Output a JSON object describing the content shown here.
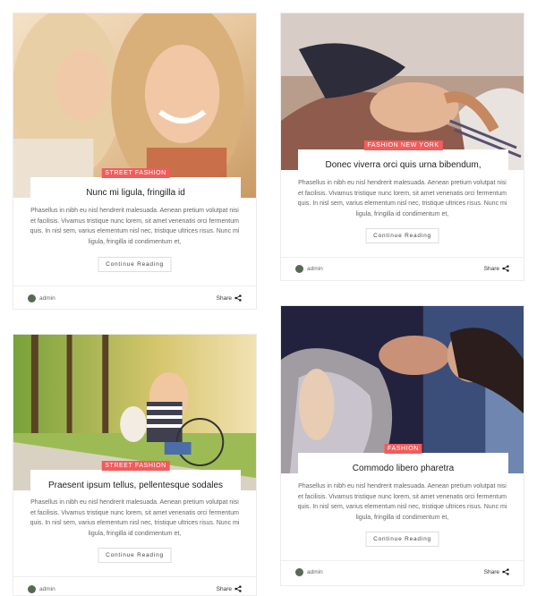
{
  "posts": [
    {
      "category": "Street Fashion",
      "title": "Nunc mi ligula, fringilla id",
      "excerpt": "Phasellus in nibh eu nisl hendrerit malesuada. Aenean pretium volutpat nisi et facilisis. Vivamus tristique nunc lorem, sit amet venenatis orci fermentum quis. In nisl sem, varius elementum nisl nec, tristique ultrices risus. Nunc mi ligula, fringilla id condimentum et,",
      "button": "Continue Reading",
      "author": "admin",
      "share": "Share"
    },
    {
      "category": "Fashion New York",
      "title": "Donec viverra orci quis urna bibendum,",
      "excerpt": "Phasellus in nibh eu nisl hendrerit malesuada. Aenean pretium volutpat nisi et facilisis. Vivamus tristique nunc lorem, sit amet venenatis orci fermentum quis. In nisl sem, varius elementum nisl nec, tristique ultrices risus. Nunc mi ligula, fringilla id condimentum et,",
      "button": "Continue Reading",
      "author": "admin",
      "share": "Share"
    },
    {
      "category": "Street Fashion",
      "title": "Praesent ipsum tellus, pellentesque sodales",
      "excerpt": "Phasellus in nibh eu nisl hendrerit malesuada. Aenean pretium volutpat nisi et facilisis. Vivamus tristique nunc lorem, sit amet venenatis orci fermentum quis. In nisl sem, varius elementum nisl nec, tristique ultrices risus. Nunc mi ligula, fringilla id condimentum et,",
      "button": "Continue Reading",
      "author": "admin",
      "share": "Share"
    },
    {
      "category": "Fashion",
      "title": "Commodo libero pharetra",
      "excerpt": "Phasellus in nibh eu nisl hendrerit malesuada. Aenean pretium volutpat nisi et facilisis. Vivamus tristique nunc lorem, sit amet venenatis orci fermentum quis. In nisl sem, varius elementum nisl nec, tristique ultrices risus. Nunc mi ligula, fringilla id condimentum et,",
      "button": "Continue Reading",
      "author": "admin",
      "share": "Share"
    }
  ],
  "colors": {
    "category_badge": "#f25c5c",
    "border": "#ececec"
  }
}
